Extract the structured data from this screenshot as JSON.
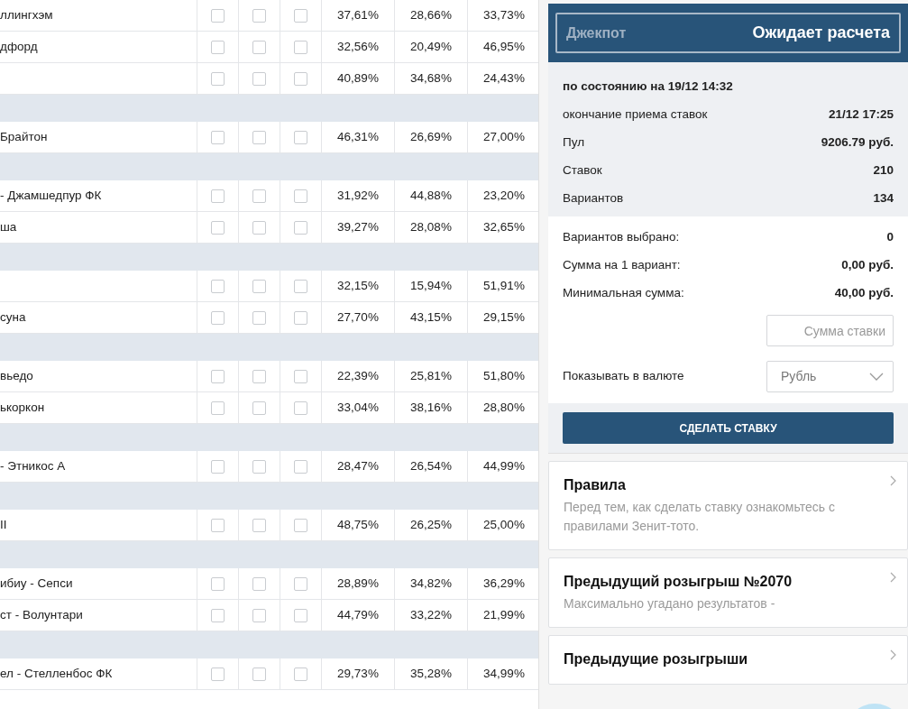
{
  "table": {
    "rows": [
      {
        "kind": "match",
        "name": "ллингхэм",
        "picks": [
          false,
          false,
          false
        ],
        "odds": [
          "37,61%",
          "28,66%",
          "33,73%"
        ]
      },
      {
        "kind": "match",
        "name": "дфорд",
        "picks": [
          false,
          false,
          false
        ],
        "odds": [
          "32,56%",
          "20,49%",
          "46,95%"
        ]
      },
      {
        "kind": "match",
        "picks": [
          false,
          false,
          false
        ],
        "odds": [
          "40,89%",
          "34,68%",
          "24,43%"
        ]
      },
      {
        "kind": "separator"
      },
      {
        "kind": "match",
        "name": "Брайтон",
        "picks": [
          false,
          false,
          false
        ],
        "odds": [
          "46,31%",
          "26,69%",
          "27,00%"
        ]
      },
      {
        "kind": "separator"
      },
      {
        "kind": "match",
        "name": "- Джамшедпур ФК",
        "picks": [
          false,
          false,
          false
        ],
        "odds": [
          "31,92%",
          "44,88%",
          "23,20%"
        ]
      },
      {
        "kind": "match",
        "name": "ша",
        "picks": [
          false,
          false,
          false
        ],
        "odds": [
          "39,27%",
          "28,08%",
          "32,65%"
        ]
      },
      {
        "kind": "separator"
      },
      {
        "kind": "match",
        "picks": [
          false,
          false,
          false
        ],
        "odds": [
          "32,15%",
          "15,94%",
          "51,91%"
        ]
      },
      {
        "kind": "match",
        "name": "суна",
        "picks": [
          false,
          false,
          false
        ],
        "odds": [
          "27,70%",
          "43,15%",
          "29,15%"
        ]
      },
      {
        "kind": "separator"
      },
      {
        "kind": "match",
        "name": "вьедо",
        "picks": [
          false,
          false,
          false
        ],
        "odds": [
          "22,39%",
          "25,81%",
          "51,80%"
        ]
      },
      {
        "kind": "match",
        "name": "ькоркон",
        "picks": [
          false,
          false,
          false
        ],
        "odds": [
          "33,04%",
          "38,16%",
          "28,80%"
        ]
      },
      {
        "kind": "separator"
      },
      {
        "kind": "match",
        "name": "- Этникос А",
        "picks": [
          false,
          false,
          false
        ],
        "odds": [
          "28,47%",
          "26,54%",
          "44,99%"
        ]
      },
      {
        "kind": "separator"
      },
      {
        "kind": "match",
        "name": "II",
        "picks": [
          false,
          false,
          false
        ],
        "odds": [
          "48,75%",
          "26,25%",
          "25,00%"
        ]
      },
      {
        "kind": "separator"
      },
      {
        "kind": "match",
        "name": "ибиу - Сепси",
        "picks": [
          false,
          false,
          false
        ],
        "odds": [
          "28,89%",
          "34,82%",
          "36,29%"
        ]
      },
      {
        "kind": "match",
        "name": "ст - Волунтари",
        "picks": [
          false,
          false,
          false
        ],
        "odds": [
          "44,79%",
          "33,22%",
          "21,99%"
        ]
      },
      {
        "kind": "separator"
      },
      {
        "kind": "match",
        "name": "ел - Стелленбос ФК",
        "picks": [
          false,
          false,
          false
        ],
        "odds": [
          "29,73%",
          "35,28%",
          "34,99%"
        ]
      }
    ]
  },
  "jackpot": {
    "label": "Джекпот",
    "status": "Ожидает расчета"
  },
  "info": {
    "as_of": "по состоянию на 19/12 14:32",
    "rows": [
      {
        "label": "окончание приема ставок",
        "value": "21/12 17:25"
      },
      {
        "label": "Пул",
        "value": "9206.79 руб."
      },
      {
        "label": "Ставок",
        "value": "210"
      },
      {
        "label": "Вариантов",
        "value": "134"
      }
    ]
  },
  "bet": {
    "rows": [
      {
        "label": "Вариантов выбрано:",
        "value": "0"
      },
      {
        "label": "Сумма на 1 вариант:",
        "value": "0,00 руб."
      },
      {
        "label": "Минимальная сумма:",
        "value": "40,00 руб."
      }
    ],
    "amount_placeholder": "Сумма ставки",
    "currency_label": "Показывать в валюте",
    "currency": "Рубль",
    "button": "СДЕЛАТЬ СТАВКУ"
  },
  "links": [
    {
      "title": "Правила",
      "text": "Перед тем, как сделать ставку ознакомьтесь с правилами Зенит-тото."
    },
    {
      "title": "Предыдущий розыгрыш №2070",
      "text": "Максимально угадано результатов -"
    },
    {
      "title": "Предыдущие розыгрыши"
    }
  ]
}
